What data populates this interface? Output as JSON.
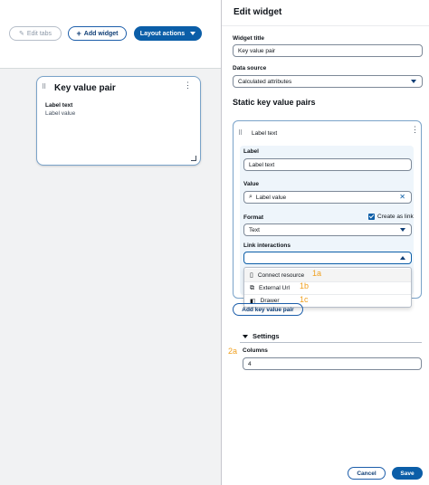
{
  "toolbar": {
    "edit_tabs": "Edit tabs",
    "add_widget": "Add widget",
    "layout_actions": "Layout actions"
  },
  "card": {
    "title": "Key value pair",
    "label": "Label text",
    "value": "Label value"
  },
  "panel": {
    "title": "Edit widget",
    "widget_title_label": "Widget title",
    "widget_title_value": "Key value pair",
    "data_source_label": "Data source",
    "data_source_value": "Calculated attributes",
    "static_title": "Static key value pairs",
    "kv_header": "Label text",
    "label_field_label": "Label",
    "label_field_value": "Label text",
    "value_field_label": "Value",
    "value_field_value": "Label value",
    "format_label": "Format",
    "create_link_label": "Create as link",
    "format_value": "Text",
    "link_interactions_label": "Link interactions",
    "link_options": [
      "Connect resource",
      "External Url",
      "Drawer"
    ],
    "annotations": [
      "1a",
      "1b",
      "1c",
      "2a"
    ],
    "add_kv_button": "Add key value pair",
    "settings_title": "Settings",
    "columns_label": "Columns",
    "columns_value": "4",
    "cancel": "Cancel",
    "save": "Save"
  },
  "colors": {
    "primary": "#0b5ea8",
    "annotation": "#f0a020",
    "accent_border": "#7aa3c9"
  }
}
